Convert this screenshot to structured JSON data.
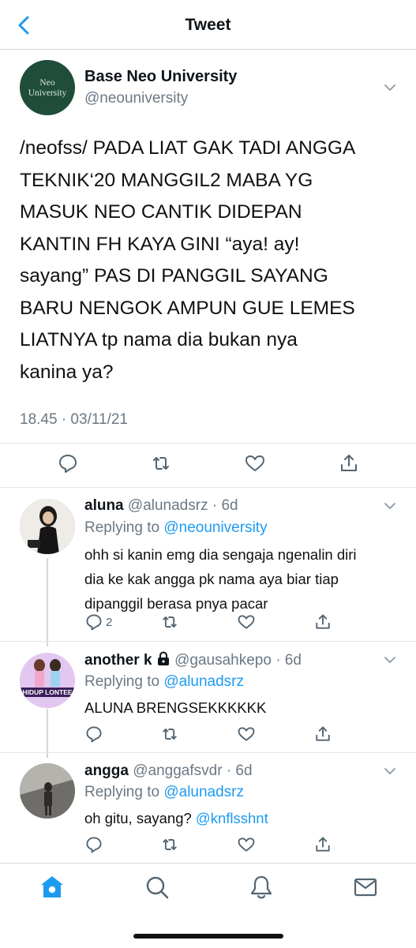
{
  "header": {
    "title": "Tweet"
  },
  "main_tweet": {
    "avatar_text": [
      "Neo",
      "University"
    ],
    "display_name": "Base Neo University",
    "handle": "@neouniversity",
    "text_lines": [
      "/neofss/ PADA LIAT GAK TADI ANGGA",
      "TEKNIK‘20 MANGGIL2 MABA YG",
      "MASUK NEO CANTIK DIDEPAN",
      "KANTIN FH KAYA GINI “aya! ay!",
      "sayang” PAS DI PANGGIL SAYANG",
      "BARU NENGOK AMPUN GUE LEMES",
      "LIATNYA tp nama dia bukan nya",
      "kanina ya?"
    ],
    "timestamp": "18.45 · 03/11/21"
  },
  "replies": [
    {
      "name": "aluna",
      "handle": "@alunadsrz · 6d",
      "replying_prefix": "Replying to ",
      "replying_to": "@neouniversity",
      "text_lines": [
        "ohh si kanin emg dia sengaja ngenalin diri",
        "dia ke kak angga pk nama aya biar tiap",
        "dipanggil berasa pnya pacar"
      ],
      "reply_count": "2"
    },
    {
      "name": "another k",
      "handle": "@gausahkepo · 6d",
      "avatar_text": "HIDUP LONTEE",
      "replying_prefix": "Replying to ",
      "replying_to": "@alunadsrz",
      "text_lines": [
        "ALUNA BRENGSEKKKKKK"
      ],
      "reply_count": ""
    },
    {
      "name": "angga",
      "handle": "@anggafsvdr · 6d",
      "replying_prefix": "Replying to ",
      "replying_to": "@alunadsrz",
      "text": "oh gitu, sayang? ",
      "mention": "@knflsshnt",
      "reply_count": ""
    }
  ],
  "colors": {
    "accent": "#1d9bf0",
    "secondary_text": "#6b7884"
  },
  "icons": [
    "chevron-left-icon",
    "chevron-down-icon",
    "reply-icon",
    "retweet-icon",
    "like-icon",
    "share-icon",
    "lock-icon",
    "home-icon",
    "search-icon",
    "bell-icon",
    "mail-icon"
  ]
}
